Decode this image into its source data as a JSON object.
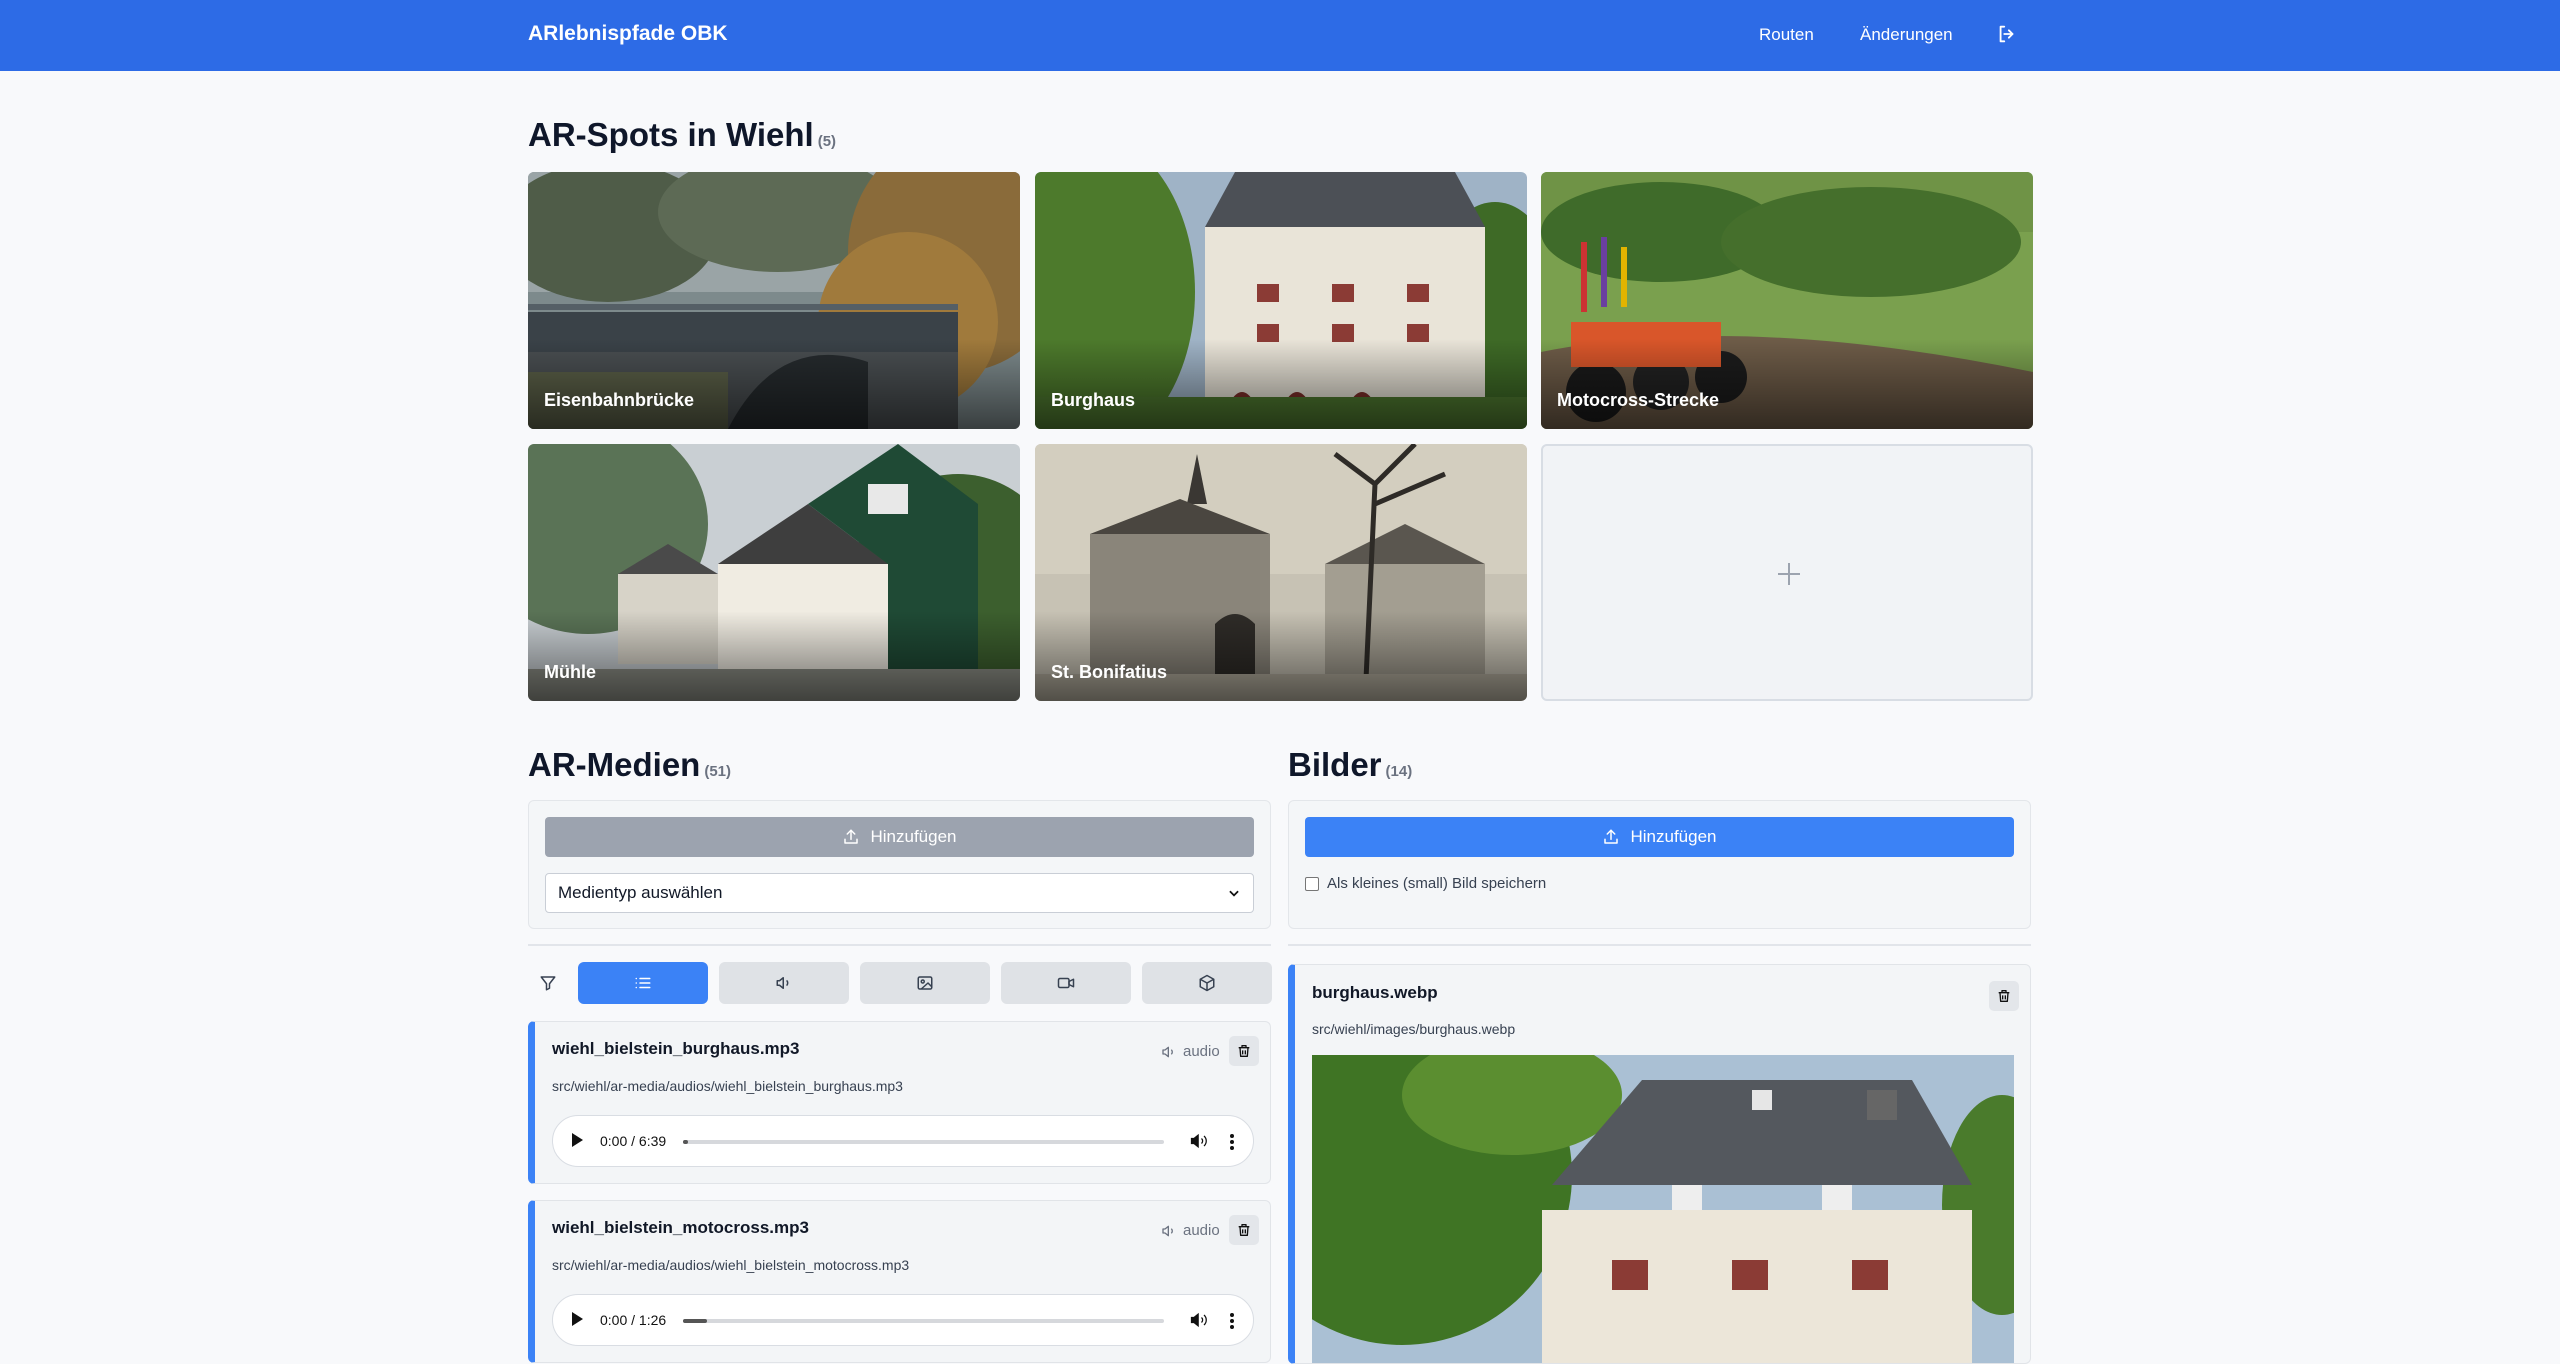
{
  "header": {
    "app_title": "ARlebnispfade OBK",
    "nav": [
      "Routen",
      "Änderungen"
    ],
    "logout_icon": "logout-icon"
  },
  "spots": {
    "title": "AR-Spots in Wiehl",
    "count": "(5)",
    "items": [
      {
        "label": "Eisenbahnbrücke"
      },
      {
        "label": "Burghaus"
      },
      {
        "label": "Motocross-Strecke"
      },
      {
        "label": "Mühle"
      },
      {
        "label": "St. Bonifatius"
      }
    ],
    "add_icon": "plus-icon"
  },
  "media": {
    "title": "AR-Medien",
    "count": "(51)",
    "add_label": "Hinzufügen",
    "select_value": "Medientyp auswählen",
    "filters": [
      "list-icon",
      "audio-icon",
      "image-icon",
      "video-icon",
      "cube-icon"
    ],
    "items": [
      {
        "name": "wiehl_bielstein_burghaus.mp3",
        "path": "src/wiehl/ar-media/audios/wiehl_bielstein_burghaus.mp3",
        "type": "audio",
        "time": "0:00 / 6:39",
        "progress": 0.01
      },
      {
        "name": "wiehl_bielstein_motocross.mp3",
        "path": "src/wiehl/ar-media/audios/wiehl_bielstein_motocross.mp3",
        "type": "audio",
        "time": "0:00 / 1:26",
        "progress": 0.05
      }
    ]
  },
  "images": {
    "title": "Bilder",
    "count": "(14)",
    "add_label": "Hinzufügen",
    "checkbox_label": "Als kleines (small) Bild speichern",
    "items": [
      {
        "name": "burghaus.webp",
        "path": "src/wiehl/images/burghaus.webp"
      }
    ]
  },
  "colors": {
    "primary": "#2d6be6",
    "accent": "#3b82f6",
    "disabled": "#9ca3af"
  }
}
